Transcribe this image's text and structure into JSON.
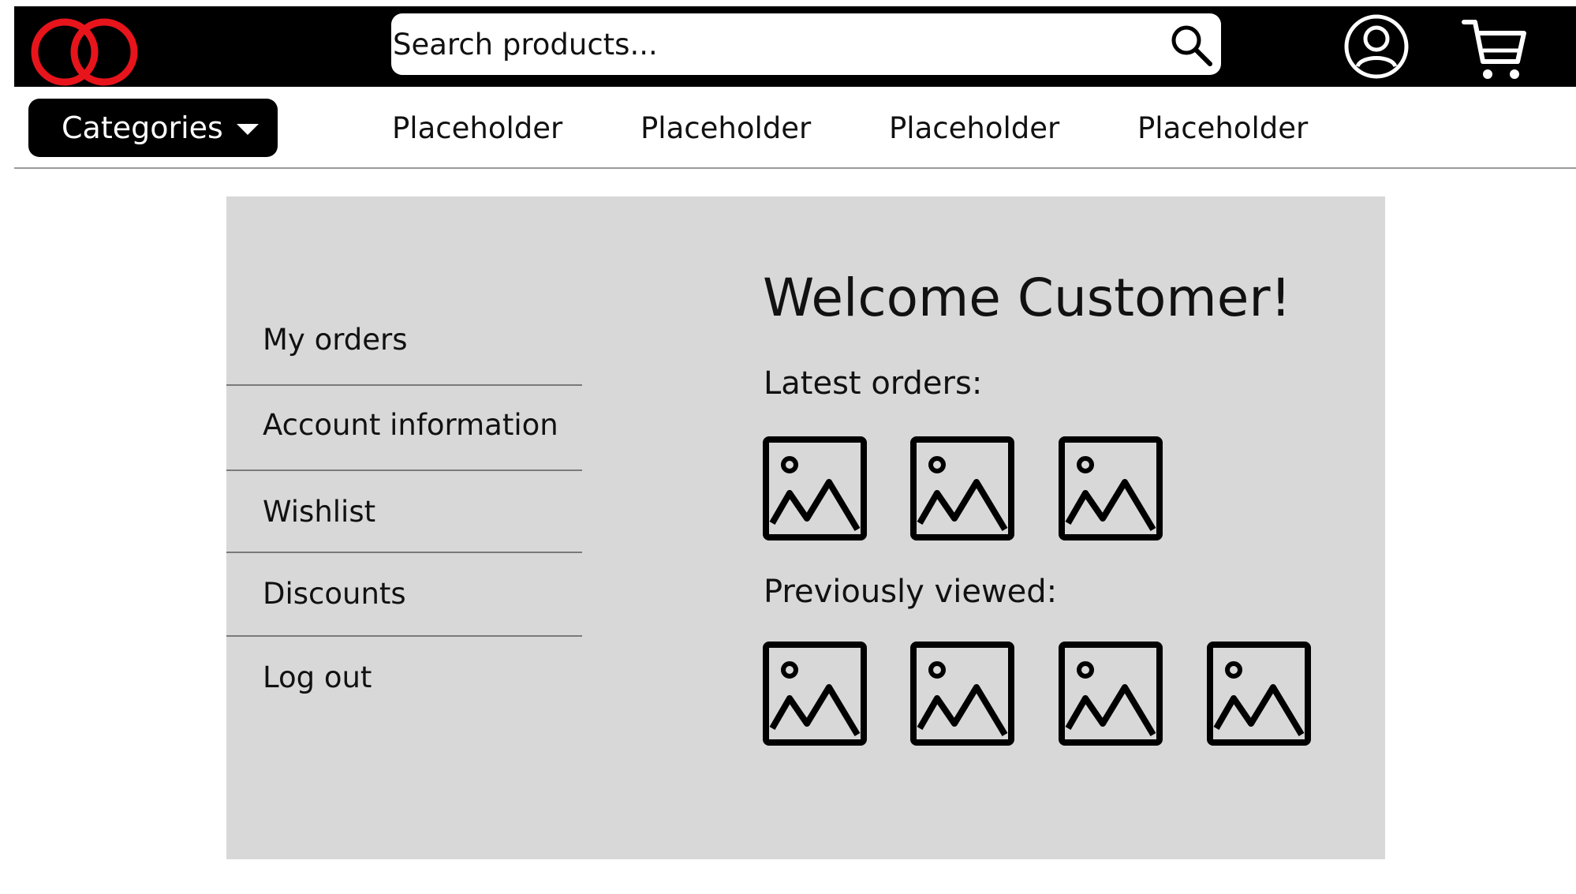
{
  "header": {
    "search": {
      "placeholder": "Search products..."
    },
    "logo_colors": {
      "ring": "#e8141c"
    },
    "icons": [
      "search-icon",
      "account-icon",
      "cart-icon"
    ]
  },
  "nav": {
    "categories_label": "Categories",
    "links": [
      "Placeholder",
      "Placeholder",
      "Placeholder",
      "Placeholder"
    ]
  },
  "account": {
    "menu": [
      "My orders",
      "Account information",
      "Wishlist",
      "Discounts",
      "Log out"
    ],
    "welcome": "Welcome Customer!",
    "latest_orders_label": "Latest orders:",
    "previously_viewed_label": "Previously viewed:"
  },
  "colors": {
    "header_bg": "#000000",
    "panel_bg": "#d8d8d8",
    "accent": "#e8141c"
  }
}
